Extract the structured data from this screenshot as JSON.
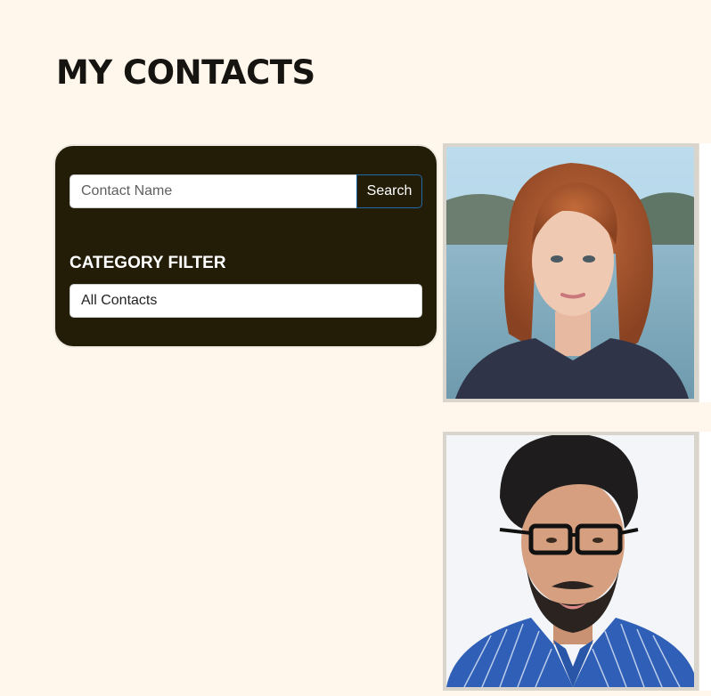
{
  "header": {
    "title": "MY CONTACTS"
  },
  "search": {
    "placeholder": "Contact Name",
    "value": "",
    "button_label": "Search"
  },
  "filter": {
    "heading": "CATEGORY FILTER",
    "selected": "All Contacts"
  },
  "contacts": [
    {
      "photo": "woman-portrait-photo"
    },
    {
      "photo": "man-portrait-photo"
    }
  ],
  "colors": {
    "page_background": "#fff7eb",
    "panel_background": "#231d08",
    "button_border": "#1e6aa6",
    "text_dark": "#161411"
  }
}
